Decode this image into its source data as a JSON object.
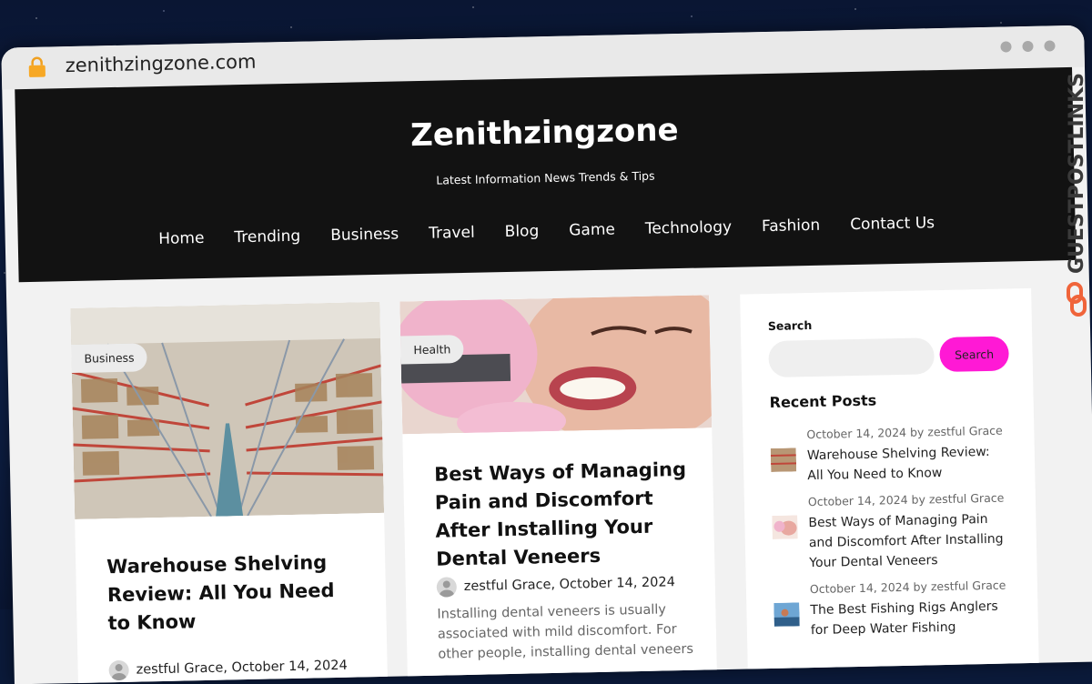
{
  "browser": {
    "url": "zenithzingzone.com"
  },
  "site": {
    "title": "Zenithzingzone",
    "tagline": "Latest Information News Trends & Tips"
  },
  "nav": {
    "items": [
      "Home",
      "Trending",
      "Business",
      "Travel",
      "Blog",
      "Game",
      "Technology",
      "Fashion",
      "Contact Us"
    ]
  },
  "posts": [
    {
      "category": "Business",
      "title": "Warehouse Shelving Review: All You Need to Know",
      "author_date": "zestful Grace, October 14, 2024",
      "excerpt": ""
    },
    {
      "category": "Health",
      "title": "Best Ways of Managing Pain and Discomfort After Installing Your Dental Veneers",
      "author_date": "zestful Grace, October 14, 2024",
      "excerpt": "Installing dental veneers is usually associated with mild discomfort. For other people, installing dental veneers"
    }
  ],
  "sidebar": {
    "search_label": "Search",
    "search_placeholder": "",
    "search_button": "Search",
    "recent_title": "Recent Posts",
    "recent": [
      {
        "meta": "October 14, 2024 by zestful Grace",
        "title": "Warehouse Shelving Review: All You Need to Know"
      },
      {
        "meta": "October 14, 2024 by zestful Grace",
        "title": "Best Ways of Managing Pain and Discomfort After Installing Your Dental Veneers"
      },
      {
        "meta": "October 14, 2024 by zestful Grace",
        "title": "The Best Fishing Rigs Anglers for Deep Water Fishing"
      }
    ]
  },
  "watermark": {
    "text": "GUESTPOSTLINKS"
  },
  "colors": {
    "header_bg": "#121212",
    "search_button": "#ff19d5",
    "page_bg": "#f2f2f2"
  }
}
